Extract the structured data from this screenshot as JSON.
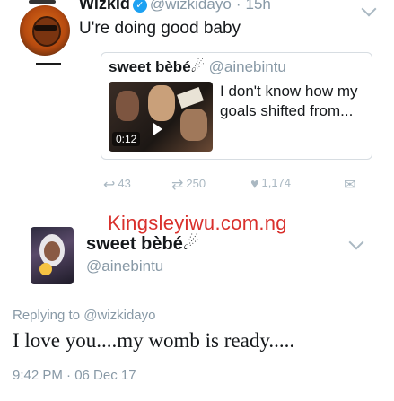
{
  "colors": {
    "verified": "#1da1f2",
    "muted_text": "#8899a6",
    "watermark": "#d9302c",
    "border": "#d7dde2"
  },
  "main_tweet": {
    "author_name": "Wizkid",
    "verified_icon": "verified-badge-icon",
    "handle": "@wizkidayo",
    "separator": "·",
    "time": "15h",
    "text": "U're doing good baby",
    "quoted_tweet": {
      "author_name": "sweet bèbé☄",
      "handle": "@ainebintu",
      "video_duration": "0:12",
      "text": "I don't know how my goals shifted from..."
    },
    "actions": {
      "reply_count": "43",
      "retweet_count": "250",
      "like_count": "1,174"
    }
  },
  "watermark": "Kingsleyiwu.com.ng",
  "reply_tweet": {
    "author_name": "sweet bèbé☄",
    "handle": "@ainebintu",
    "replying_to_label": "Replying to",
    "replying_to_handle": "@wizkidayo",
    "text": "I love you....my womb is ready.....",
    "timestamp": "9:42 PM · 06 Dec 17"
  }
}
